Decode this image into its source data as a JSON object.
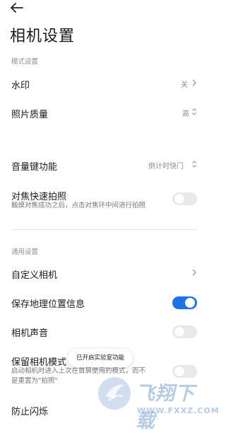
{
  "header": {
    "title": "相机设置"
  },
  "sections": {
    "mode": "模式设置",
    "general": "通用设置"
  },
  "rows": {
    "watermark": {
      "title": "水印",
      "value": "关"
    },
    "photo_quality": {
      "title": "照片质量",
      "value": "高"
    },
    "volume_key": {
      "title": "音量键功能",
      "value": "倒计时快门"
    },
    "focus_shoot": {
      "title": "对焦快速拍照",
      "subtitle": "触摸对焦成功之后，点击对焦环中间进行拍照",
      "on": false
    },
    "custom_camera": {
      "title": "自定义相机"
    },
    "save_location": {
      "title": "保存地理位置信息",
      "on": true
    },
    "camera_sound": {
      "title": "相机声音",
      "on": false
    },
    "keep_mode": {
      "title": "保留相机模式",
      "subtitle_line1": "启动相机时进入上次在首屏使用的模式，而不",
      "subtitle_line2": "是重置为\"拍照\"",
      "on": false
    },
    "anti_flicker": {
      "title": "防止闪烁"
    }
  },
  "toast": {
    "text": "已开启实验室功能"
  },
  "watermark_logo": {
    "title": "飞翔下载",
    "url": "WWW.FXXZ.COM"
  },
  "colors": {
    "accent": "#1a73e8",
    "toggle_off": "#e9e9e9"
  },
  "icons": {
    "back": "back-arrow-icon",
    "chevron": "chevron-right-icon",
    "updown": "up-down-arrow-icon"
  }
}
